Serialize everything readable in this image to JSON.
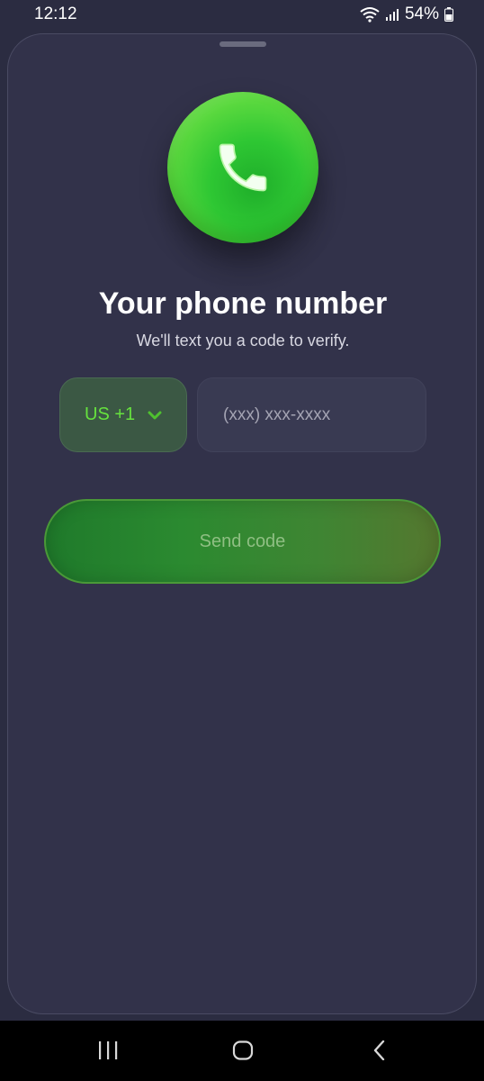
{
  "status_bar": {
    "time": "12:12",
    "battery": "54%"
  },
  "logo": {
    "icon": "phone-icon",
    "color": "#2ec733"
  },
  "header": {
    "title": "Your phone number",
    "subtitle": "We'll text you a code to verify."
  },
  "form": {
    "country_code": "US +1",
    "phone_placeholder": "(xxx) xxx-xxxx",
    "phone_value": ""
  },
  "actions": {
    "send_label": "Send code"
  },
  "nav_bar": {
    "recent_icon": "recent-apps-icon",
    "home_icon": "home-icon",
    "back_icon": "back-icon"
  },
  "colors": {
    "accent": "#66e23e",
    "background": "#32324a"
  }
}
